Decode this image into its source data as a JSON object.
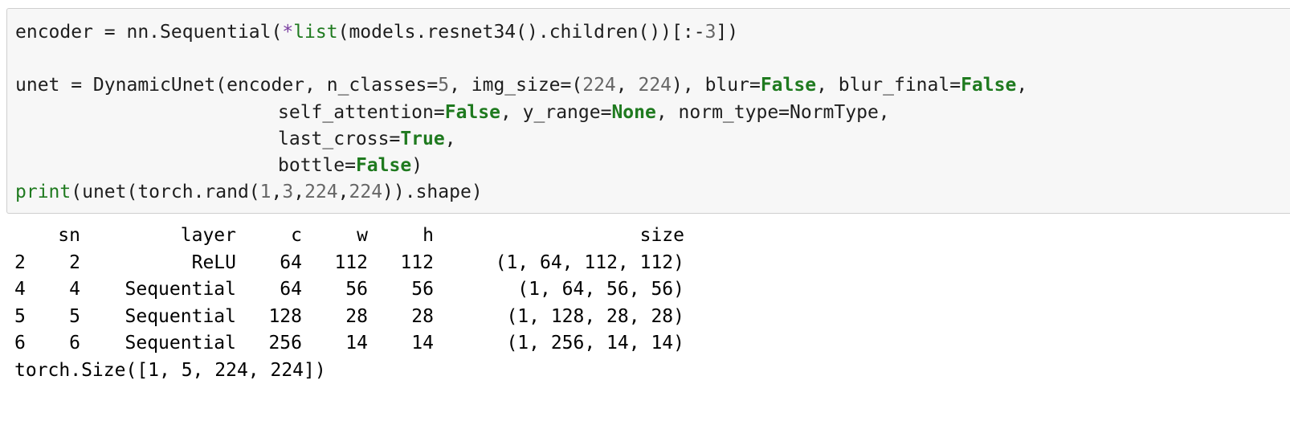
{
  "code_cell": {
    "lines": [
      [
        {
          "t": "encoder = nn.Sequential(",
          "c": "plain"
        },
        {
          "t": "*",
          "c": "op"
        },
        {
          "t": "list",
          "c": "builtin"
        },
        {
          "t": "(models.resnet34().children())[:-",
          "c": "plain"
        },
        {
          "t": "3",
          "c": "num"
        },
        {
          "t": "])",
          "c": "plain"
        }
      ],
      [],
      [
        {
          "t": "unet = DynamicUnet(encoder, n_classes=",
          "c": "plain"
        },
        {
          "t": "5",
          "c": "num"
        },
        {
          "t": ", img_size=(",
          "c": "plain"
        },
        {
          "t": "224",
          "c": "num"
        },
        {
          "t": ", ",
          "c": "plain"
        },
        {
          "t": "224",
          "c": "num"
        },
        {
          "t": "), blur=",
          "c": "plain"
        },
        {
          "t": "False",
          "c": "kw"
        },
        {
          "t": ", blur_final=",
          "c": "plain"
        },
        {
          "t": "False",
          "c": "kw"
        },
        {
          "t": ",",
          "c": "plain"
        }
      ],
      [
        {
          "t": "self_attention=",
          "c": "plain",
          "indent": true
        },
        {
          "t": "False",
          "c": "kw"
        },
        {
          "t": ", y_range=",
          "c": "plain"
        },
        {
          "t": "None",
          "c": "kw"
        },
        {
          "t": ", norm_type=NormType,",
          "c": "plain"
        }
      ],
      [
        {
          "t": "last_cross=",
          "c": "plain",
          "indent": true
        },
        {
          "t": "True",
          "c": "kw"
        },
        {
          "t": ",",
          "c": "plain"
        }
      ],
      [
        {
          "t": "bottle=",
          "c": "plain",
          "indent": true
        },
        {
          "t": "False",
          "c": "kw"
        },
        {
          "t": ")",
          "c": "plain"
        }
      ],
      [
        {
          "t": "print",
          "c": "builtin"
        },
        {
          "t": "(unet(torch.rand(",
          "c": "plain"
        },
        {
          "t": "1",
          "c": "num"
        },
        {
          "t": ",",
          "c": "plain"
        },
        {
          "t": "3",
          "c": "num"
        },
        {
          "t": ",",
          "c": "plain"
        },
        {
          "t": "224",
          "c": "num"
        },
        {
          "t": ",",
          "c": "plain"
        },
        {
          "t": "224",
          "c": "num"
        },
        {
          "t": ")).shape)",
          "c": "plain"
        }
      ]
    ]
  },
  "output": {
    "table": {
      "columns": [
        "",
        "sn",
        "layer",
        "c",
        "w",
        "h",
        "size"
      ],
      "rows": [
        [
          "2",
          "2",
          "ReLU",
          "64",
          "112",
          "112",
          "(1, 64, 112, 112)"
        ],
        [
          "4",
          "4",
          "Sequential",
          "64",
          "56",
          "56",
          "(1, 64, 56, 56)"
        ],
        [
          "5",
          "5",
          "Sequential",
          "128",
          "28",
          "28",
          "(1, 128, 28, 28)"
        ],
        [
          "6",
          "6",
          "Sequential",
          "256",
          "14",
          "14",
          "(1, 256, 14, 14)"
        ]
      ]
    },
    "shape_line": "torch.Size([1, 5, 224, 224])"
  },
  "colors": {
    "cell_background": "#f7f7f7",
    "cell_border": "#cfcfcf",
    "keyword": "#1f7a1f",
    "number": "#666666",
    "operator": "#7a3ea0"
  }
}
